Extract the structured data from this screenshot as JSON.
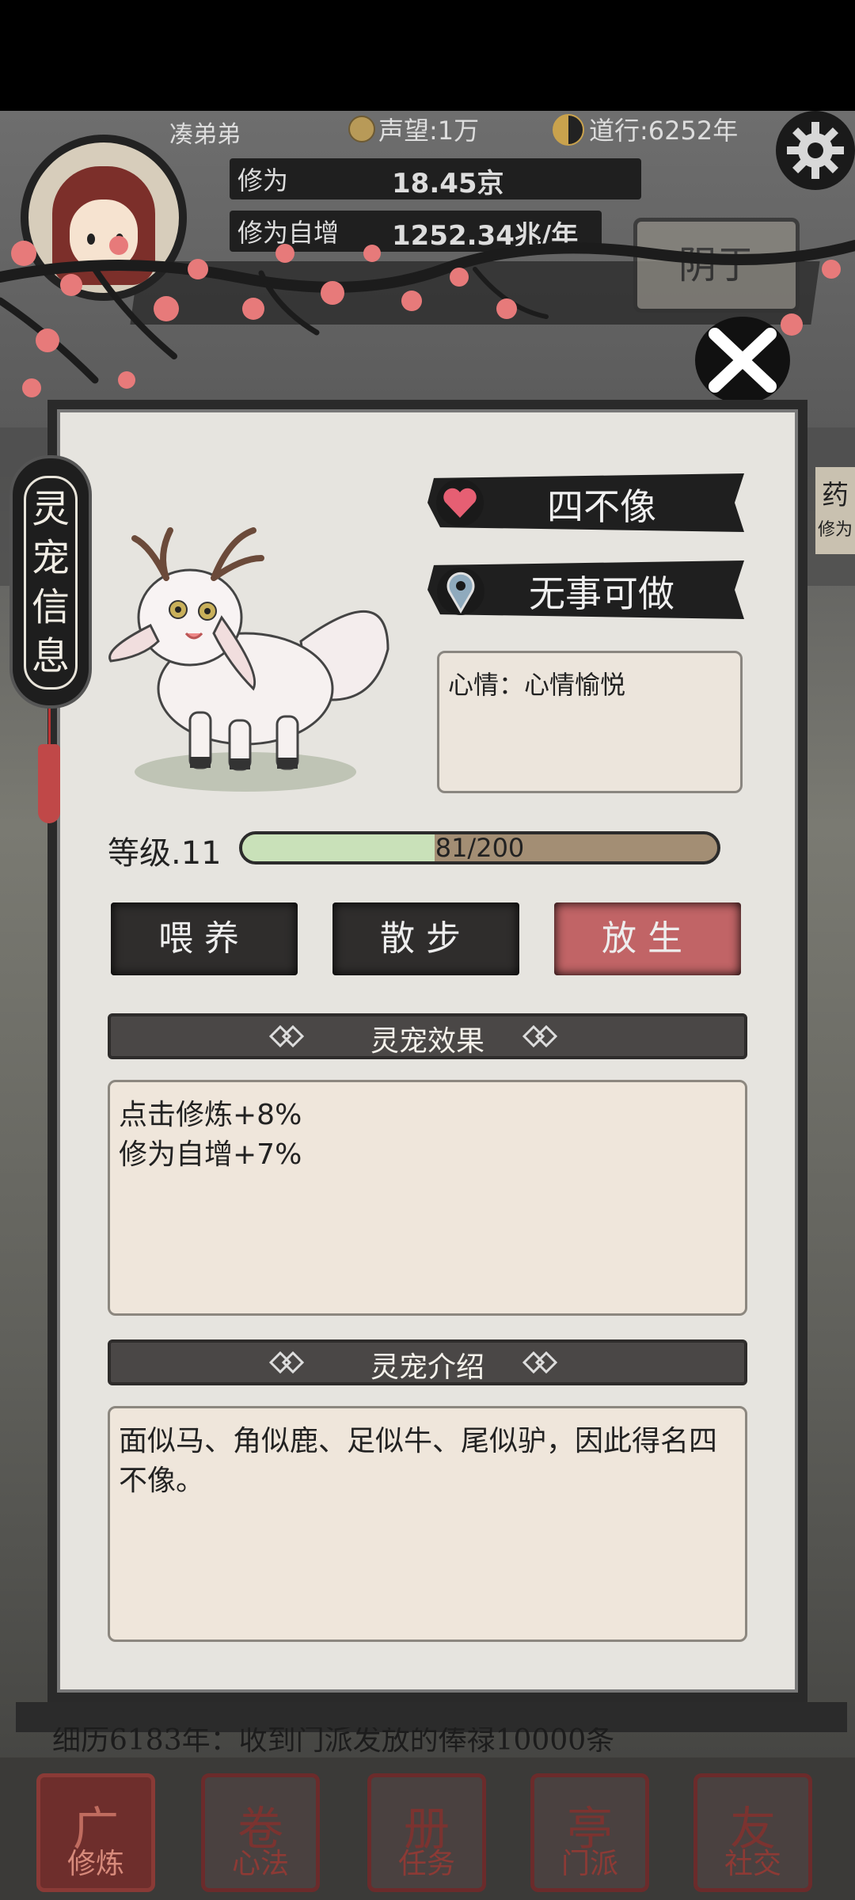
{
  "header": {
    "player_name": "凑弟弟",
    "reputation": "声望:1万",
    "dao_age": "道行:6252年",
    "stats": [
      {
        "label": "修为",
        "value": "18.45京"
      },
      {
        "label": "修为自增",
        "value": "1252.34兆/年"
      }
    ]
  },
  "background": {
    "sign_text": "阴于",
    "side_label": "药",
    "side_sublabel": "修为"
  },
  "panel": {
    "title": "灵宠信息",
    "pet_name": "四不像",
    "pet_status": "无事可做",
    "mood": "心情：心情愉悦",
    "level": "等级.11",
    "xp_text": "81/200",
    "xp_fraction": 0.405,
    "actions": [
      {
        "label": "喂养"
      },
      {
        "label": "散步"
      },
      {
        "label": "放生"
      }
    ],
    "effects": {
      "title": "灵宠效果",
      "lines": [
        "点击修炼+8%",
        "修为自增+7%"
      ]
    },
    "intro": {
      "title": "灵宠介绍",
      "text": "面似马、角似鹿、足似牛、尾似驴，因此得名四不像。"
    }
  },
  "ticker": "细历6183年：收到门派发放的俸禄10000条",
  "nav": [
    {
      "label": "修炼",
      "glyph": "广",
      "icon": "meditate-icon",
      "active": true
    },
    {
      "label": "心法",
      "glyph": "卷",
      "icon": "scroll-icon",
      "active": false
    },
    {
      "label": "任务",
      "glyph": "册",
      "icon": "task-icon",
      "active": false
    },
    {
      "label": "门派",
      "glyph": "亭",
      "icon": "sect-icon",
      "active": false
    },
    {
      "label": "社交",
      "glyph": "友",
      "icon": "social-icon",
      "active": false
    }
  ],
  "colors": {
    "release_button": "#c16466",
    "xp_fill": "#c9e1b9",
    "blossom": "#e77a7a"
  }
}
